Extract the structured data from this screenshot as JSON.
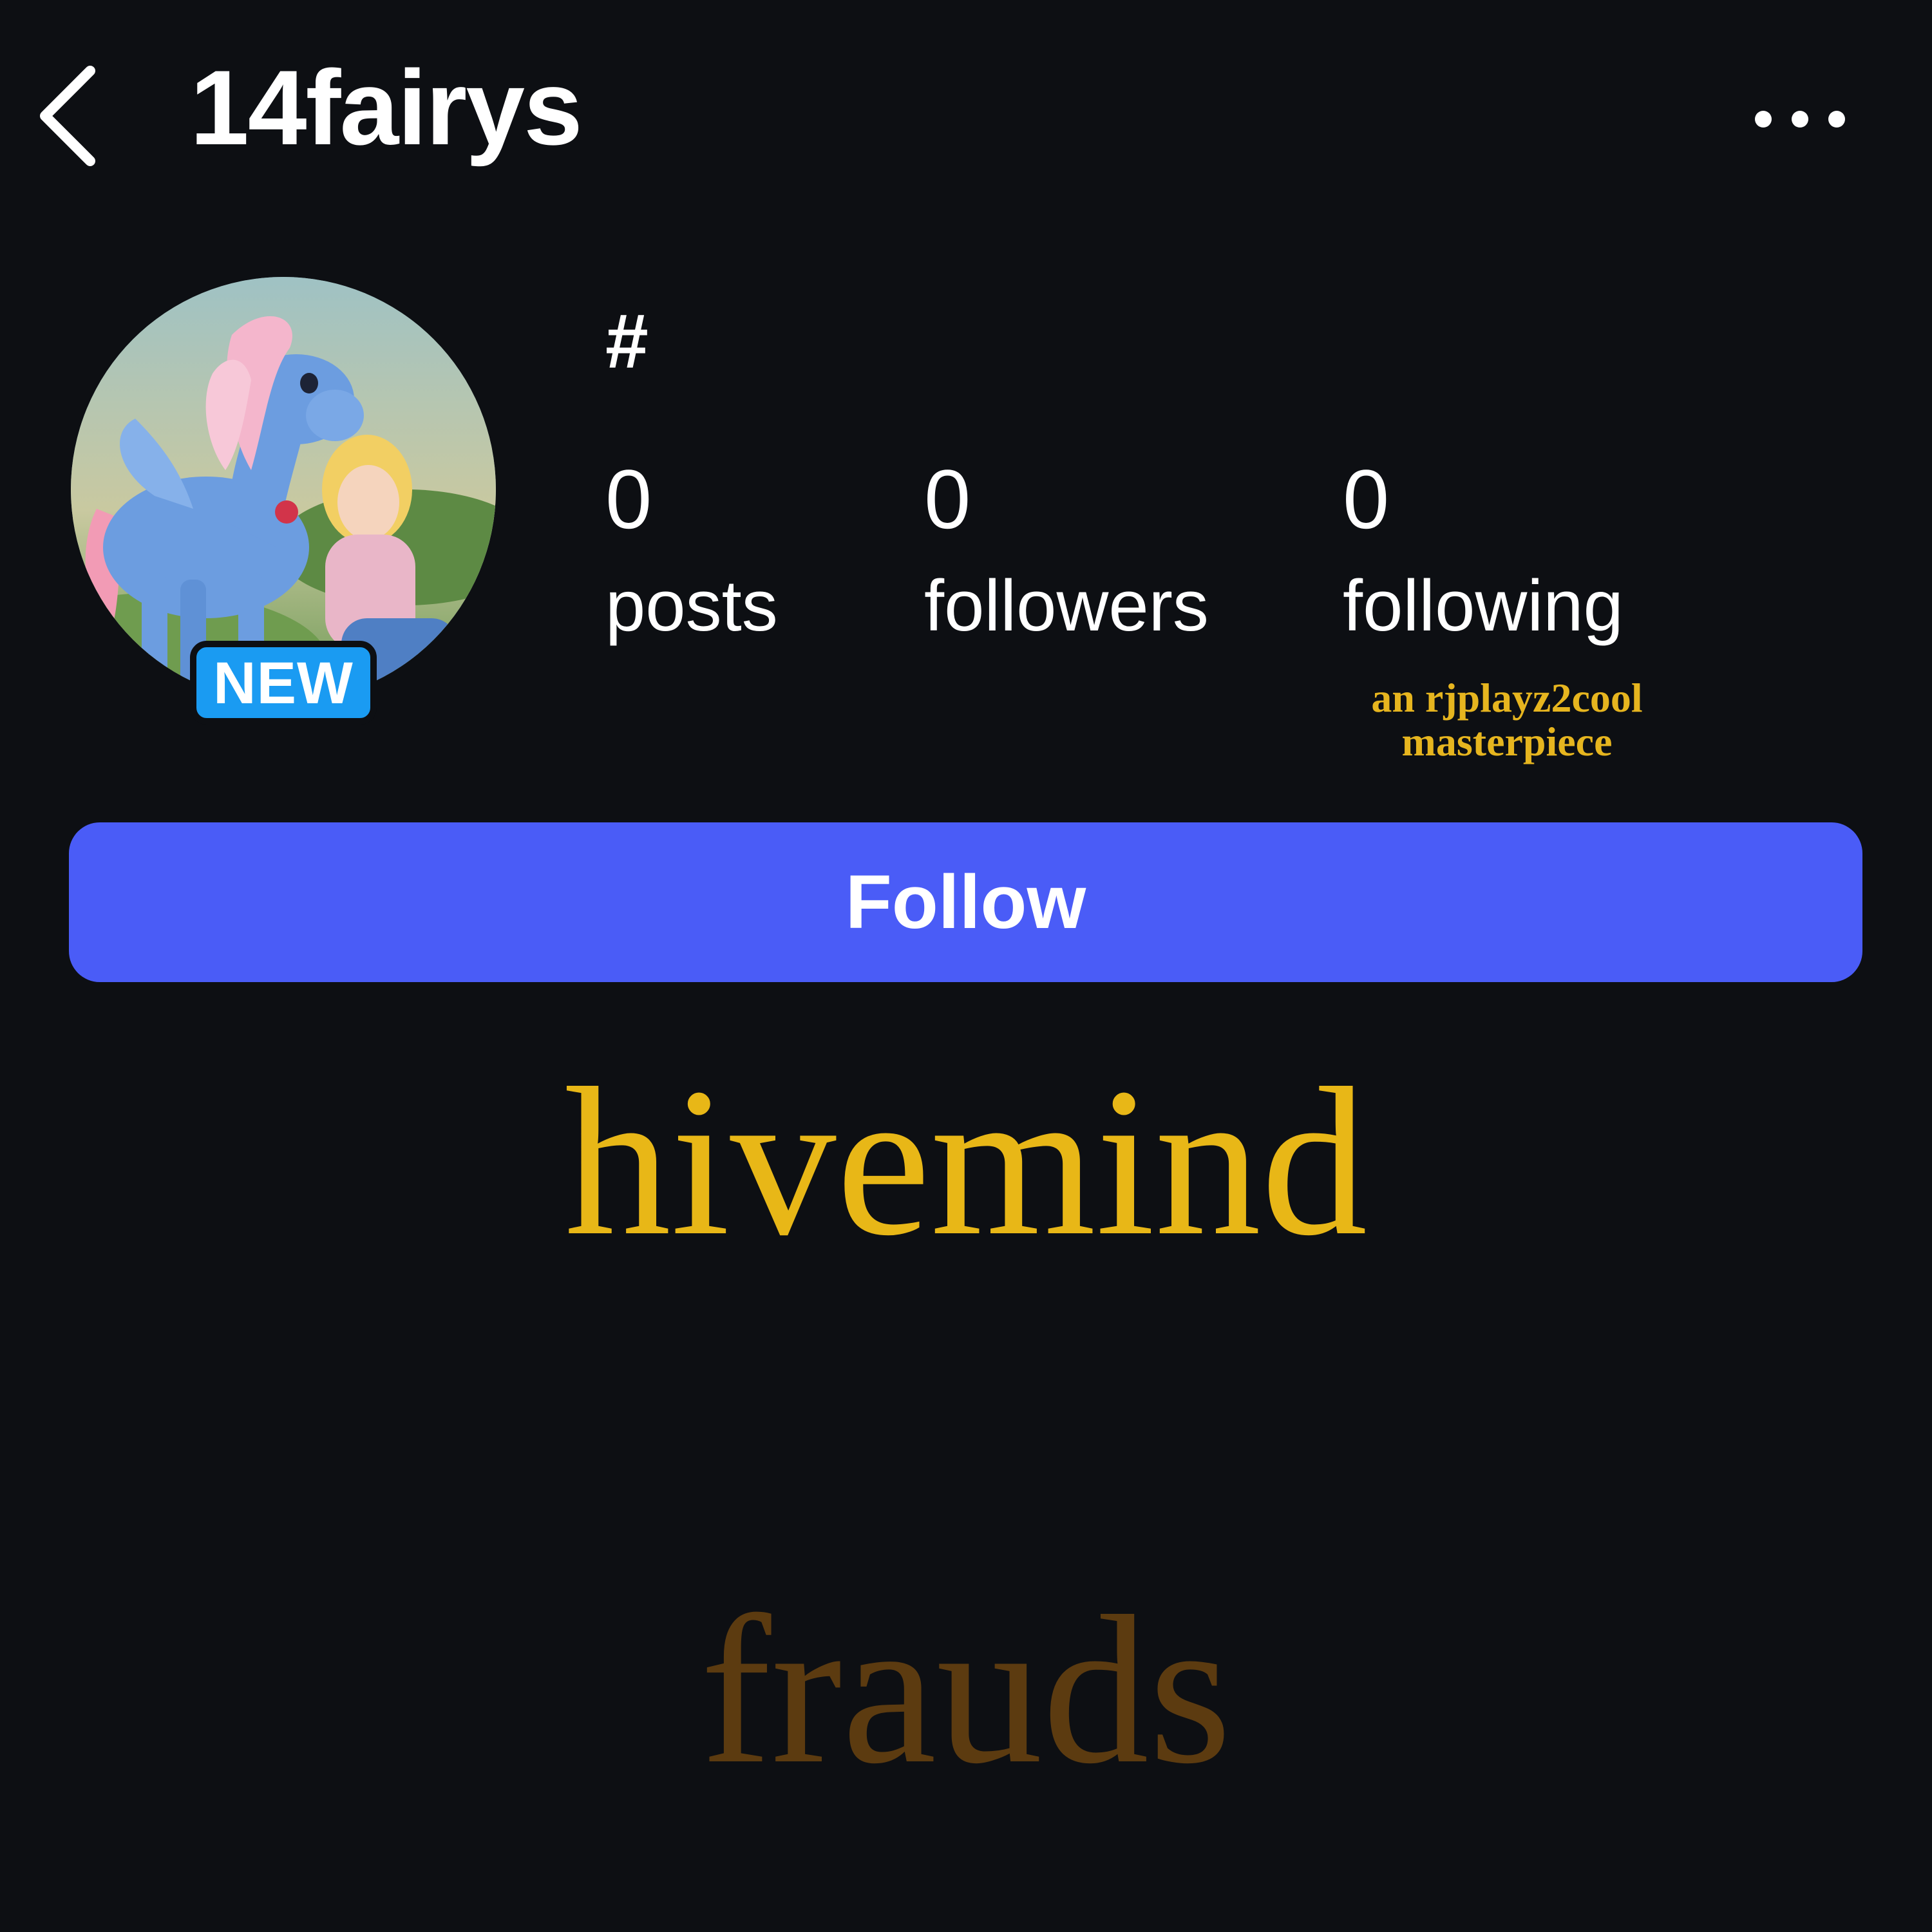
{
  "header": {
    "username": "14fairys",
    "back_icon": "chevron-left-icon",
    "more_icon": "ellipsis-icon"
  },
  "profile": {
    "avatar": "avatar-pony-illustration",
    "badge": "NEW",
    "bio": "#",
    "stats": {
      "posts_count": "0",
      "posts_label": "posts",
      "followers_count": "0",
      "followers_label": "followers",
      "following_count": "0",
      "following_label": "following"
    },
    "credit_line1": "an rjplayz2cool",
    "credit_line2": "masterpiece"
  },
  "actions": {
    "follow_label": "Follow"
  },
  "overlay": {
    "title": "hivemind",
    "subtitle": "frauds"
  },
  "colors": {
    "background": "#0d0f13",
    "follow_button": "#4a5cf7",
    "badge": "#1a9bf2",
    "gold": "#e8b717",
    "dark_gold": "#5c3b10"
  }
}
